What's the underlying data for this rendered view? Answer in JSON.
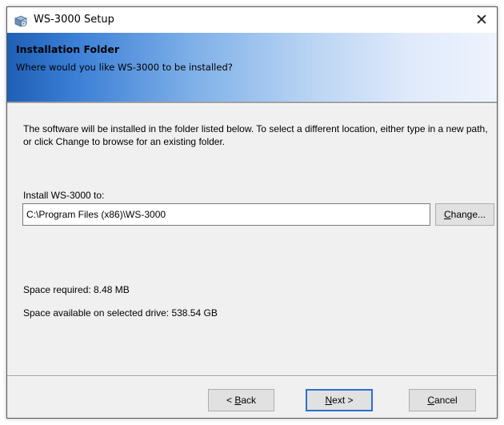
{
  "window": {
    "title": "WS-3000 Setup",
    "close_glyph": "✕",
    "icon": "installer-box-icon"
  },
  "banner": {
    "title": "Installation Folder",
    "subtitle": "Where would you like WS-3000 to be installed?"
  },
  "body": {
    "description": "The software will be installed in the folder listed below. To select a different location, either type in a new path, or click Change to browse for an existing folder.",
    "install_label": "Install WS-3000 to:",
    "install_path": "C:\\Program Files (x86)\\WS-3000",
    "change_button": {
      "mnemonic": "C",
      "rest": "hange..."
    },
    "space_required": "Space required: 8.48 MB",
    "space_available": "Space available on selected drive: 538.54 GB"
  },
  "footer": {
    "back_button": {
      "prefix": "< ",
      "mnemonic": "B",
      "rest": "ack"
    },
    "next_button": {
      "mnemonic": "N",
      "rest": "ext >"
    },
    "cancel_button": {
      "mnemonic": "C",
      "rest": "ancel"
    }
  },
  "colors": {
    "banner_start": "#1f5fb5",
    "banner_end": "#eef3fc",
    "dialog_bg": "#f0f0f0",
    "default_button_border": "#2f6fce"
  }
}
